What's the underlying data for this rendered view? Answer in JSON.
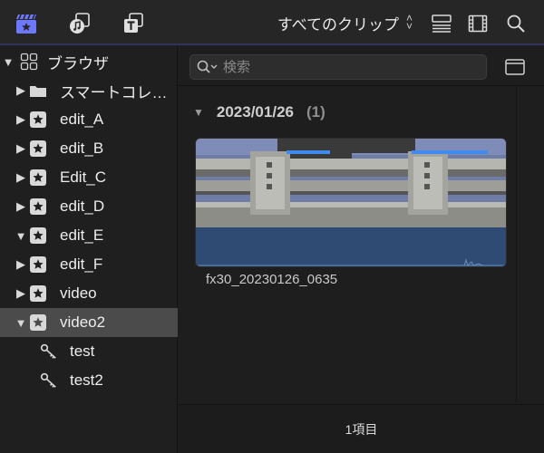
{
  "toolbar": {
    "clip_filter": "すべてのクリップ",
    "icons": [
      "libraries-icon",
      "photos-audio-icon",
      "titles-generators-icon",
      "clip-appearance-icon",
      "filmstrip-icon",
      "search-icon"
    ]
  },
  "sidebar": {
    "root_label": "ブラウザ",
    "items": [
      {
        "label": "スマートコレ…",
        "type": "folder",
        "expanded": false
      },
      {
        "label": "edit_A",
        "type": "event",
        "expanded": false
      },
      {
        "label": "edit_B",
        "type": "event",
        "expanded": false
      },
      {
        "label": "Edit_C",
        "type": "event",
        "expanded": false
      },
      {
        "label": "edit_D",
        "type": "event",
        "expanded": false
      },
      {
        "label": "edit_E",
        "type": "event",
        "expanded": true
      },
      {
        "label": "edit_F",
        "type": "event",
        "expanded": false
      },
      {
        "label": "video",
        "type": "event",
        "expanded": false
      },
      {
        "label": "video2",
        "type": "event",
        "expanded": true,
        "selected": true
      },
      {
        "label": "test",
        "type": "keyword"
      },
      {
        "label": "test2",
        "type": "keyword"
      }
    ]
  },
  "browser": {
    "search_placeholder": "検索",
    "group": {
      "date": "2023/01/26",
      "count": "(1)"
    },
    "clip": {
      "name": "fx30_20230126_0635"
    },
    "footer": "1項目"
  },
  "colors": {
    "accent": "#6e78ff",
    "selection": "#4b4b4b",
    "audio": "#2f4b73",
    "range_bar": "#3f8cf0"
  }
}
